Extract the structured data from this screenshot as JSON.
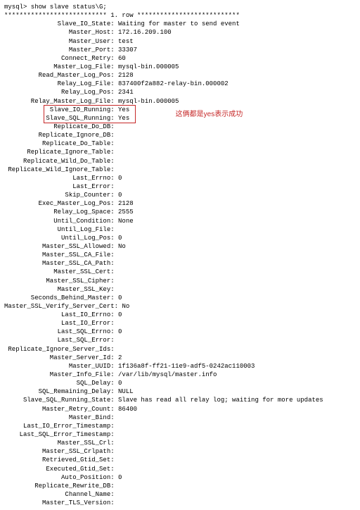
{
  "prompt": "mysql> show slave status\\G;",
  "row_separator": "*************************** 1. row ***************************",
  "annotation": "这俩都是yes表示成功",
  "label_width": 28,
  "highlight_indices": [
    12,
    13
  ],
  "fields": [
    {
      "label": "Slave_IO_State",
      "value": "Waiting for master to send event"
    },
    {
      "label": "Master_Host",
      "value": "172.16.209.100"
    },
    {
      "label": "Master_User",
      "value": "test"
    },
    {
      "label": "Master_Port",
      "value": "33307"
    },
    {
      "label": "Connect_Retry",
      "value": "60"
    },
    {
      "label": "Master_Log_File",
      "value": "mysql-bin.000005"
    },
    {
      "label": "Read_Master_Log_Pos",
      "value": "2128"
    },
    {
      "label": "Relay_Log_File",
      "value": "837400f2a882-relay-bin.000002"
    },
    {
      "label": "Relay_Log_Pos",
      "value": "2341"
    },
    {
      "label": "Relay_Master_Log_File",
      "value": "mysql-bin.000005"
    },
    {
      "label": "Slave_IO_Running",
      "value": "Yes"
    },
    {
      "label": "Slave_SQL_Running",
      "value": "Yes"
    },
    {
      "label": "Replicate_Do_DB",
      "value": ""
    },
    {
      "label": "Replicate_Ignore_DB",
      "value": ""
    },
    {
      "label": "Replicate_Do_Table",
      "value": ""
    },
    {
      "label": "Replicate_Ignore_Table",
      "value": ""
    },
    {
      "label": "Replicate_Wild_Do_Table",
      "value": ""
    },
    {
      "label": "Replicate_Wild_Ignore_Table",
      "value": ""
    },
    {
      "label": "Last_Errno",
      "value": "0"
    },
    {
      "label": "Last_Error",
      "value": ""
    },
    {
      "label": "Skip_Counter",
      "value": "0"
    },
    {
      "label": "Exec_Master_Log_Pos",
      "value": "2128"
    },
    {
      "label": "Relay_Log_Space",
      "value": "2555"
    },
    {
      "label": "Until_Condition",
      "value": "None"
    },
    {
      "label": "Until_Log_File",
      "value": ""
    },
    {
      "label": "Until_Log_Pos",
      "value": "0"
    },
    {
      "label": "Master_SSL_Allowed",
      "value": "No"
    },
    {
      "label": "Master_SSL_CA_File",
      "value": ""
    },
    {
      "label": "Master_SSL_CA_Path",
      "value": ""
    },
    {
      "label": "Master_SSL_Cert",
      "value": ""
    },
    {
      "label": "Master_SSL_Cipher",
      "value": ""
    },
    {
      "label": "Master_SSL_Key",
      "value": ""
    },
    {
      "label": "Seconds_Behind_Master",
      "value": "0"
    },
    {
      "label": "Master_SSL_Verify_Server_Cert",
      "value": "No"
    },
    {
      "label": "Last_IO_Errno",
      "value": "0"
    },
    {
      "label": "Last_IO_Error",
      "value": ""
    },
    {
      "label": "Last_SQL_Errno",
      "value": "0"
    },
    {
      "label": "Last_SQL_Error",
      "value": ""
    },
    {
      "label": "Replicate_Ignore_Server_Ids",
      "value": ""
    },
    {
      "label": "Master_Server_Id",
      "value": "2"
    },
    {
      "label": "Master_UUID",
      "value": "1f136a8f-ff21-11e9-adf5-0242ac110003"
    },
    {
      "label": "Master_Info_File",
      "value": "/var/lib/mysql/master.info"
    },
    {
      "label": "SQL_Delay",
      "value": "0"
    },
    {
      "label": "SQL_Remaining_Delay",
      "value": "NULL"
    },
    {
      "label": "Slave_SQL_Running_State",
      "value": "Slave has read all relay log; waiting for more updates"
    },
    {
      "label": "Master_Retry_Count",
      "value": "86400"
    },
    {
      "label": "Master_Bind",
      "value": ""
    },
    {
      "label": "Last_IO_Error_Timestamp",
      "value": ""
    },
    {
      "label": "Last_SQL_Error_Timestamp",
      "value": ""
    },
    {
      "label": "Master_SSL_Crl",
      "value": ""
    },
    {
      "label": "Master_SSL_Crlpath",
      "value": ""
    },
    {
      "label": "Retrieved_Gtid_Set",
      "value": ""
    },
    {
      "label": "Executed_Gtid_Set",
      "value": ""
    },
    {
      "label": "Auto_Position",
      "value": "0"
    },
    {
      "label": "Replicate_Rewrite_DB",
      "value": ""
    },
    {
      "label": "Channel_Name",
      "value": ""
    },
    {
      "label": "Master_TLS_Version",
      "value": ""
    }
  ]
}
